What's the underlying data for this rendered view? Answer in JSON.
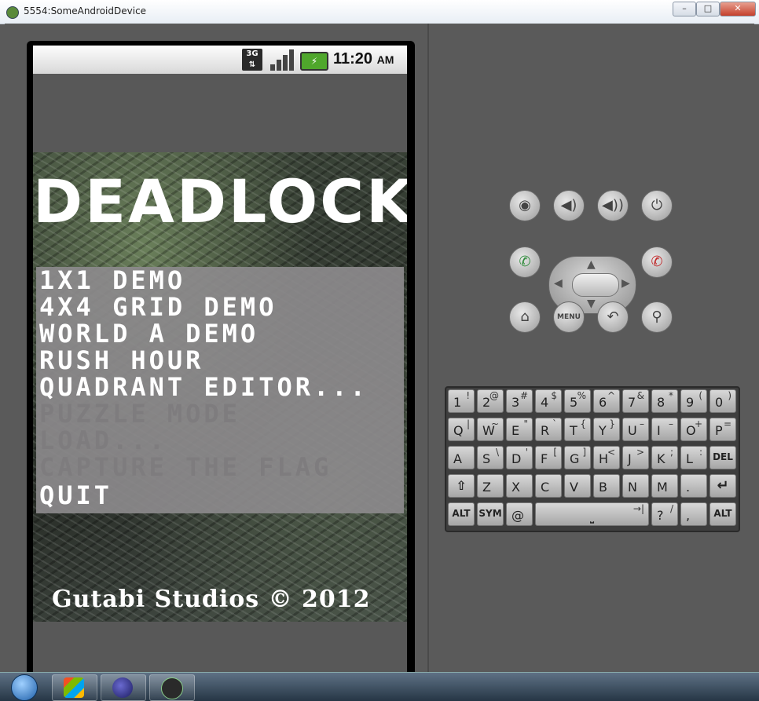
{
  "window": {
    "title": "5554:SomeAndroidDevice",
    "min": "–",
    "max": "□",
    "close": "✕"
  },
  "status_bar": {
    "network": "3G",
    "time": "11:20",
    "ampm": "AM",
    "battery_glyph": "⚡"
  },
  "app": {
    "logo": "DEADLOCK",
    "menu": [
      {
        "label": "1X1 DEMO",
        "enabled": true
      },
      {
        "label": "4X4 GRID DEMO",
        "enabled": true
      },
      {
        "label": "WORLD A DEMO",
        "enabled": true
      },
      {
        "label": "RUSH HOUR",
        "enabled": true
      },
      {
        "label": "QUADRANT EDITOR...",
        "enabled": true
      },
      {
        "label": "PUZZLE MODE",
        "enabled": false
      },
      {
        "label": "LOAD...",
        "enabled": false
      },
      {
        "label": "CAPTURE THE FLAG",
        "enabled": false
      },
      {
        "label": "QUIT",
        "enabled": true
      }
    ],
    "copyright": "Gutabi Studios © 2012"
  },
  "controls": {
    "camera": "camera-icon",
    "vol_down": "volume-down-icon",
    "vol_up": "volume-up-icon",
    "power": "power-icon",
    "call": "call-icon",
    "end_call": "end-call-icon",
    "home": "home-icon",
    "menu_label": "MENU",
    "back": "back-icon",
    "search": "search-icon"
  },
  "keyboard": {
    "row1": [
      [
        "1",
        "!"
      ],
      [
        "2",
        "@"
      ],
      [
        "3",
        "#"
      ],
      [
        "4",
        "$"
      ],
      [
        "5",
        "%"
      ],
      [
        "6",
        "^"
      ],
      [
        "7",
        "&"
      ],
      [
        "8",
        "*"
      ],
      [
        "9",
        "("
      ],
      [
        "0",
        ")"
      ]
    ],
    "row2": [
      [
        "Q",
        "|"
      ],
      [
        "W",
        "~"
      ],
      [
        "E",
        "\""
      ],
      [
        "R",
        "`"
      ],
      [
        "T",
        "{"
      ],
      [
        "Y",
        "}"
      ],
      [
        "U",
        "–"
      ],
      [
        "I",
        "–"
      ],
      [
        "O",
        "+"
      ],
      [
        "P",
        "="
      ]
    ],
    "row3": [
      [
        "A",
        ""
      ],
      [
        "S",
        "\\"
      ],
      [
        "D",
        "'"
      ],
      [
        "F",
        "["
      ],
      [
        "G",
        "]"
      ],
      [
        "H",
        "<"
      ],
      [
        "J",
        ">"
      ],
      [
        "K",
        ";"
      ],
      [
        "L",
        ":"
      ],
      [
        "DEL",
        ""
      ]
    ],
    "row4": [
      [
        "⇧",
        ""
      ],
      [
        "Z",
        ""
      ],
      [
        "X",
        ""
      ],
      [
        "C",
        ""
      ],
      [
        "V",
        ""
      ],
      [
        "B",
        ""
      ],
      [
        "N",
        ""
      ],
      [
        "M",
        ""
      ],
      [
        ".",
        ""
      ],
      [
        "↵",
        ""
      ]
    ],
    "row5": {
      "alt": "ALT",
      "sym": "SYM",
      "at": "@",
      "tab": "→|",
      "slash": "/",
      "question": "?",
      "comma": ",",
      "alt2": "ALT"
    }
  },
  "colors": {
    "accent_green": "#4fa72c",
    "menu_panel": "#8c8a8c",
    "disabled_text": "#7e7c7e"
  }
}
